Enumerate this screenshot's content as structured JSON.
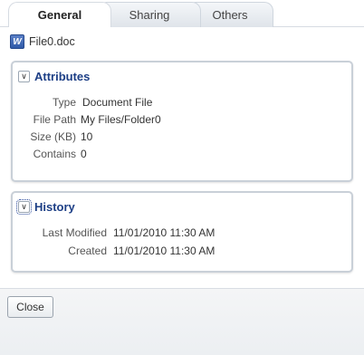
{
  "tabs": {
    "general": "General",
    "sharing": "Sharing",
    "others": "Others"
  },
  "file": {
    "name": "File0.doc",
    "icon": "word-document-icon"
  },
  "attributes": {
    "title": "Attributes",
    "toggle_icon": "collapse-icon",
    "rows": [
      {
        "label": "Type",
        "value": "Document File"
      },
      {
        "label": "File Path",
        "value": "My Files/Folder0"
      },
      {
        "label": "Size (KB)",
        "value": "10"
      },
      {
        "label": "Contains",
        "value": "0"
      }
    ]
  },
  "history": {
    "title": "History",
    "toggle_icon": "collapse-icon",
    "rows": [
      {
        "label": "Last Modified",
        "value": "11/01/2010 11:30 AM"
      },
      {
        "label": "Created",
        "value": "11/01/2010 11:30 AM"
      }
    ]
  },
  "footer": {
    "close_label": "Close"
  },
  "colors": {
    "accent": "#1d3f86",
    "border": "#c9d0d8"
  }
}
